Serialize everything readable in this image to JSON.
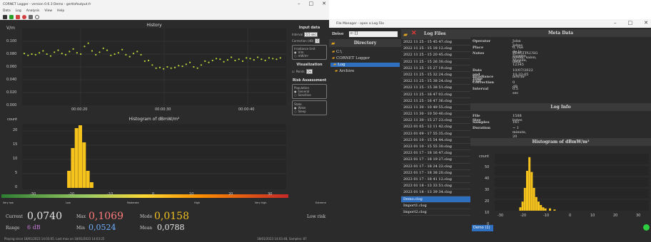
{
  "logger": {
    "title": "CORNET Logger - version 0.6.3 Demo - gertlofoutput.fr",
    "menu": [
      "Data",
      "Log",
      "Analysis",
      "View",
      "Help"
    ],
    "history_title": "History",
    "history_yunit": "V/m",
    "history_yticks": [
      "0.100",
      "0.080",
      "0.060",
      "0.040",
      "0.020",
      "0.000"
    ],
    "history_xticks": [
      "00:00:20",
      "00:00:30",
      "00:00:40"
    ],
    "histogram_title": "Histogram of dBmW/m²",
    "hist_ylabel": "count",
    "hist_yticks": [
      "20",
      "15",
      "10",
      "5",
      "0"
    ],
    "hist_xticks": [
      "-30",
      "-20",
      "-10",
      "0",
      "10",
      "20",
      "30"
    ],
    "scale_labels": [
      "Very low",
      "Low",
      "Moderate",
      "High",
      "Very high",
      "Extreme"
    ],
    "side": {
      "input_title": "Input data",
      "interval_label": "Interval",
      "interval_value": "0.5 sec",
      "correction_label": "Correction (dB)",
      "correction_value": "0",
      "irr_title": "Irradiance Unit",
      "irr_opt1": "V/m",
      "irr_opt2": "mW/m²",
      "vis_title": "Visualization",
      "points_label": "Points",
      "points_value": "On",
      "risk_title": "Risk Assessment",
      "pop_title": "Population",
      "pop_opt1": "General",
      "pop_opt2": "Sensitive",
      "state_title": "State",
      "state_opt1": "Wake",
      "state_opt2": "Sleep"
    },
    "stats": {
      "current_label": "Current",
      "current_value": "0,0740",
      "current_color": "#e8e8e8",
      "max_label": "Max",
      "max_value": "0,1069",
      "max_color": "#ff7b7b",
      "mode_label": "Mode",
      "mode_value": "0,0158",
      "mode_color": "#f0c020",
      "range_label": "Range",
      "range_value": "6 dB",
      "range_color": "#c57bd8",
      "min_label": "Min",
      "min_value": "0,0524",
      "min_color": "#6fb0ff",
      "mean_label": "Mean",
      "mean_value": "0,0788",
      "mean_color": "#e8e8e8",
      "risk": "Low risk"
    },
    "status_left": "Playing since 18/01/2023 14:03:05. Last max on 18/01/2023 14:03:25",
    "status_right": "18/01/2023 14:03:48, Samples: 87"
  },
  "filemanager": {
    "title": "File Manager - open a Log File",
    "drive_label": "Drive",
    "drive_value": "c: []",
    "log_files_title": "Log Files",
    "directory_title": "Directory",
    "tree": [
      "C:\\",
      "CORNET Logger",
      "Log",
      "Archive"
    ],
    "files": [
      "2022 11 25 - 15 45 47.clog",
      "2022 11 25 - 15 18 12.clog",
      "2022 11 25 - 15 20 45.clog",
      "2022 11 25 - 15 26 30.clog",
      "2022 11 25 - 15 27 19.clog",
      "2022 11 25 - 15 32 24.clog",
      "2022 11 25 - 15 38 24.clog",
      "2022 11 25 - 15 38 51.clog",
      "2022 11 25 - 16 47 02.clog",
      "2022 11 25 - 16 47 36.clog",
      "2022 11 30 - 10 49 55.clog",
      "2022 11 30 - 10 50 40.clog",
      "2022 11 30 - 15 27 23.clog",
      "2023 01 05 - 12 11 42.clog",
      "2023 01 09 - 17 55 35.clog",
      "2023 01 10 - 15 54 44.clog",
      "2023 01 10 - 15 55 30.clog",
      "2023 01 17 - 18 16 47.clog",
      "2023 01 17 - 18 19 27.clog",
      "2023 01 17 - 18 24 22.clog",
      "2023 01 17 - 18 38 20.clog",
      "2023 01 17 - 18 41 12.clog",
      "2023 01 18 - 13 33 51.clog",
      "2023 01 18 - 13 39 34.clog",
      "Demo.clog",
      "Import1.clog",
      "Import2.clog"
    ],
    "selected_file": "Demo.clog",
    "meta_title": "Meta Data",
    "meta": [
      {
        "k": "Operator",
        "v": "John Johns"
      },
      {
        "k": "Place",
        "v": "0, rue de la Fayette, Maville, 12345"
      },
      {
        "k": "Notes",
        "v": "ED85TPLUSG model; salon, desk"
      }
    ],
    "meta2": [
      {
        "k": "Date and Time",
        "v": "10/07/2022 10:33:05"
      },
      {
        "k": "Irradiance Unit",
        "v": "mW/m²"
      },
      {
        "k": "Correction",
        "v": "0 dB"
      },
      {
        "k": "Interval",
        "v": "0.5 sec"
      }
    ],
    "log_info_title": "Log Info",
    "info": [
      {
        "k": "File Size",
        "v": "1588 bytes"
      },
      {
        "k": "Samples",
        "v": "161"
      },
      {
        "k": "Duration",
        "v": "~ 1 minute, 20 seconds"
      }
    ],
    "hist_title": "Histogram of dBmW/m²",
    "hist_ylabel": "count",
    "hist_yticks": [
      "50",
      "40",
      "30",
      "20",
      "10",
      "0"
    ],
    "hist_xticks": [
      "-30",
      "-20",
      "-10",
      "0",
      "10",
      "20",
      "30"
    ],
    "demo_label": "Demo (1)"
  }
}
